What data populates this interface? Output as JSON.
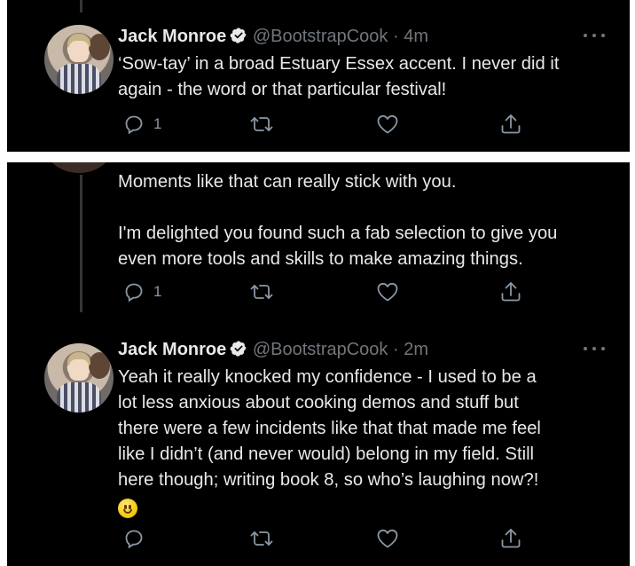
{
  "tweets": [
    {
      "name": "Jack Monroe",
      "handle": "@BootstrapCook",
      "separator": "·",
      "time": "4m",
      "text": "‘Sow-tay’ in a broad Estuary Essex accent. I never did it\nagain - the word or that particular festival!",
      "reply_count": "1"
    },
    {
      "text": "Moments like that can really stick with you.\n\nI'm delighted you found such a fab selection to give you\neven more tools and skills to make amazing things.",
      "reply_count": "1"
    },
    {
      "name": "Jack Monroe",
      "handle": "@BootstrapCook",
      "separator": "·",
      "time": "2m",
      "text": "Yeah it really knocked my confidence - I used to be a\nlot less anxious about cooking demos and stuff but\nthere were a few incidents like that that made me feel\nlike I didn’t (and never would) belong in my field. Still\nhere though; writing book 8, so who’s laughing now?!",
      "emoji": "slightly-smiling-face-emoji",
      "reply_count": ""
    }
  ],
  "icons": {
    "verified": "verified-badge-icon",
    "more": "more-options-icon",
    "reply": "reply-icon",
    "retweet": "retweet-icon",
    "like": "like-icon",
    "share": "share-icon"
  },
  "colors": {
    "background": "#000000",
    "primary_text": "#e7e9ea",
    "secondary_text": "#71767b",
    "icon": "#8b98a5",
    "thread_line": "#333639"
  }
}
